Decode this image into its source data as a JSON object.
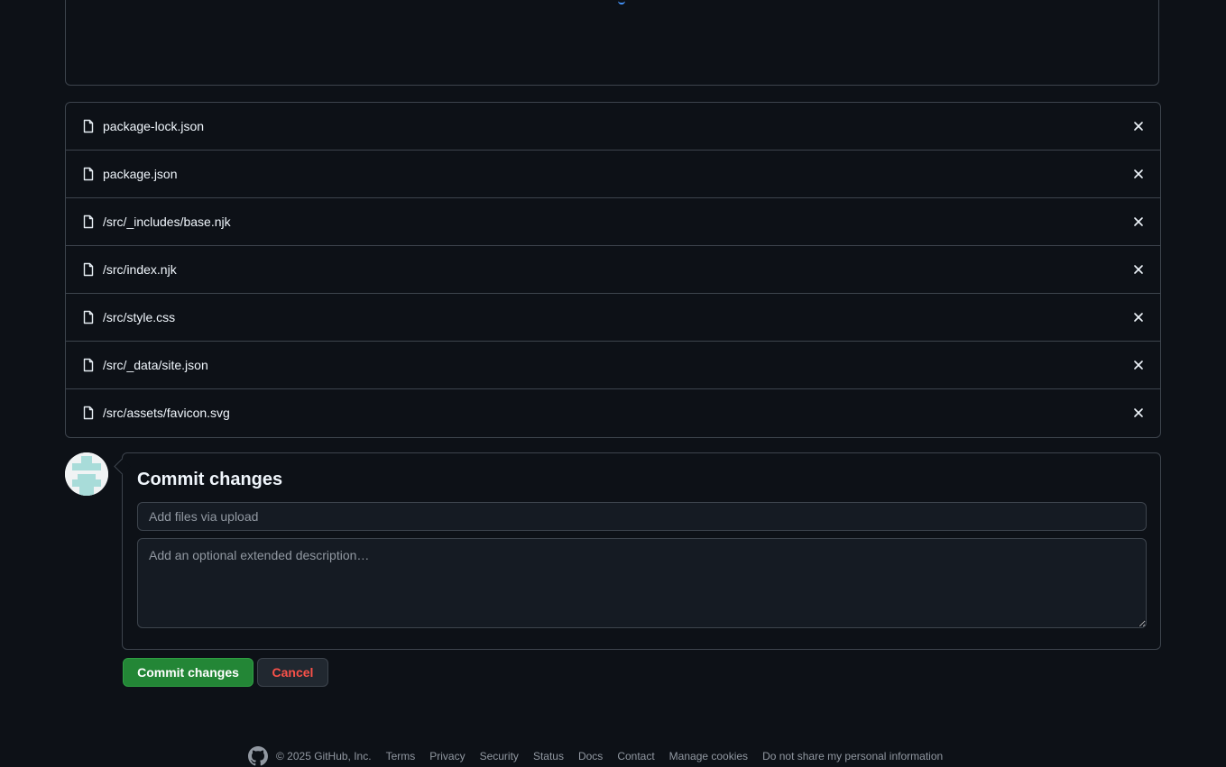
{
  "colors": {
    "background": "#0d1117",
    "border": "#3d444d",
    "primary_button": "#238636",
    "danger_text": "#f85149",
    "muted_text": "#9198a1"
  },
  "files": [
    {
      "name": "package-lock.json",
      "icon": "file-icon",
      "action_icon": "close-icon"
    },
    {
      "name": "package.json",
      "icon": "file-icon",
      "action_icon": "close-icon"
    },
    {
      "name": "/src/_includes/base.njk",
      "icon": "file-icon",
      "action_icon": "close-icon"
    },
    {
      "name": "/src/index.njk",
      "icon": "file-icon",
      "action_icon": "close-icon"
    },
    {
      "name": "/src/style.css",
      "icon": "file-icon",
      "action_icon": "close-icon"
    },
    {
      "name": "/src/_data/site.json",
      "icon": "file-icon",
      "action_icon": "close-icon"
    },
    {
      "name": "/src/assets/favicon.svg",
      "icon": "file-icon",
      "action_icon": "close-icon"
    }
  ],
  "commit": {
    "title": "Commit changes",
    "summary_placeholder": "Add files via upload",
    "summary_value": "",
    "description_placeholder": "Add an optional extended description…",
    "description_value": "",
    "commit_button": "Commit changes",
    "cancel_button": "Cancel"
  },
  "footer": {
    "logo_icon": "github-logo-icon",
    "copyright": "© 2025 GitHub, Inc.",
    "links": [
      "Terms",
      "Privacy",
      "Security",
      "Status",
      "Docs",
      "Contact",
      "Manage cookies",
      "Do not share my personal information"
    ]
  }
}
